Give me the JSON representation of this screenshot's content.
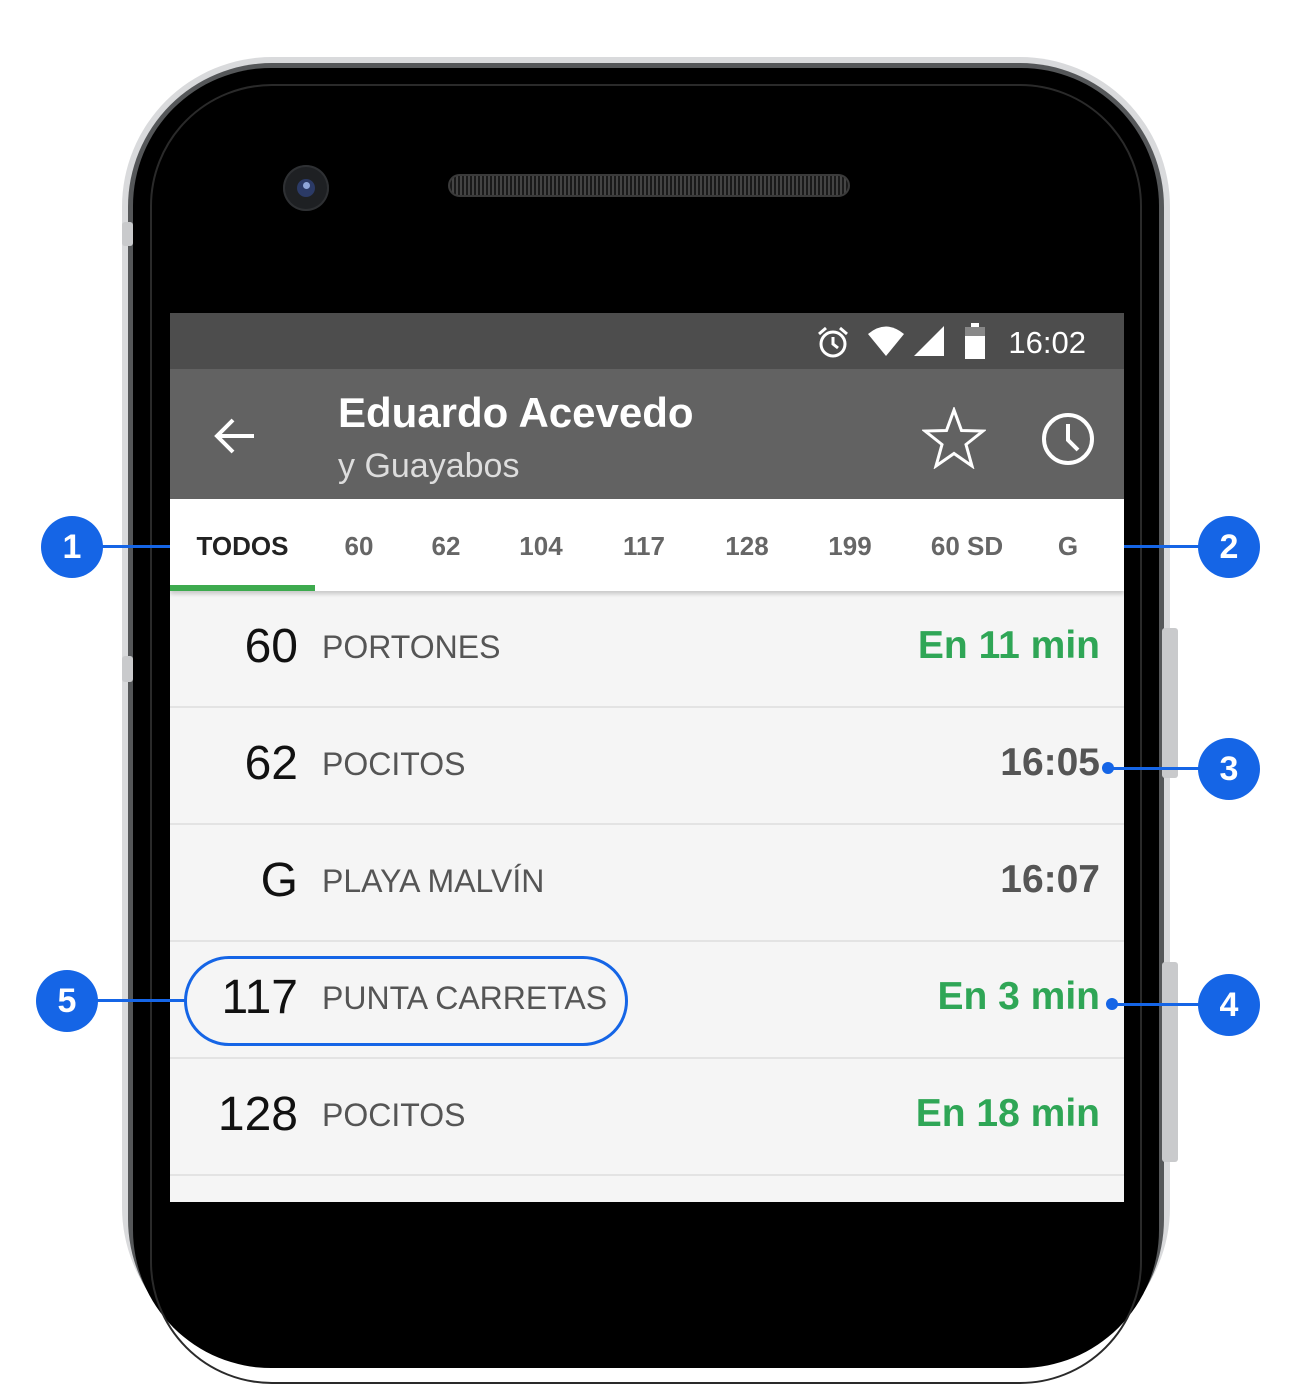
{
  "status_bar": {
    "time": "16:02",
    "icons": [
      "alarm-icon",
      "wifi-icon",
      "signal-icon",
      "battery-icon"
    ]
  },
  "app_bar": {
    "title": "Eduardo Acevedo",
    "subtitle": "y Guayabos",
    "back_icon": "arrow-left-icon",
    "favorite_icon": "star-outline-icon",
    "history_icon": "clock-icon"
  },
  "tabs": [
    {
      "label": "TODOS",
      "active": true
    },
    {
      "label": "60"
    },
    {
      "label": "62"
    },
    {
      "label": "104"
    },
    {
      "label": "117"
    },
    {
      "label": "128"
    },
    {
      "label": "199"
    },
    {
      "label": "60 SD"
    },
    {
      "label": "G"
    }
  ],
  "arrivals": [
    {
      "route": "60",
      "destination": "PORTONES",
      "eta": "En 11 min",
      "realtime": true
    },
    {
      "route": "62",
      "destination": "POCITOS",
      "eta": "16:05",
      "realtime": false
    },
    {
      "route": "G",
      "destination": "PLAYA MALVÍN",
      "eta": "16:07",
      "realtime": false
    },
    {
      "route": "117",
      "destination": "PUNTA CARRETAS",
      "eta": "En 3 min",
      "realtime": true
    },
    {
      "route": "128",
      "destination": "POCITOS",
      "eta": "En 18 min",
      "realtime": true
    }
  ],
  "callouts": [
    "1",
    "2",
    "3",
    "4",
    "5"
  ],
  "colors": {
    "realtime_green": "#2fa656",
    "callout_blue": "#1565e6",
    "toolbar": "#626262",
    "status_bar": "#4d4d4d"
  }
}
